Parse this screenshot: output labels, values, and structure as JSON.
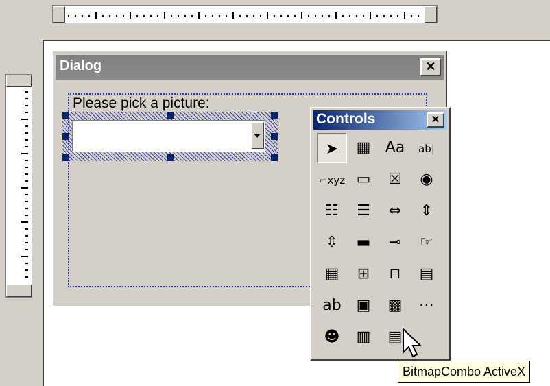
{
  "dialog": {
    "title": "Dialog",
    "close_glyph": "✕",
    "label": "Please pick a picture:"
  },
  "controls": {
    "title": "Controls",
    "close_glyph": "✕",
    "tools": [
      {
        "name": "pointer-tool-icon",
        "glyph": "➤"
      },
      {
        "name": "image-tool-icon",
        "glyph": "▦"
      },
      {
        "name": "label-tool-icon",
        "glyph": "Aa"
      },
      {
        "name": "textbox-tool-icon",
        "glyph": "ab|"
      },
      {
        "name": "frame-tool-icon",
        "glyph": "⌐xyz"
      },
      {
        "name": "button-tool-icon",
        "glyph": "▭"
      },
      {
        "name": "checkbox-tool-icon",
        "glyph": "☒"
      },
      {
        "name": "option-button-tool-icon",
        "glyph": "◉"
      },
      {
        "name": "listbox-tool-icon",
        "glyph": "☷"
      },
      {
        "name": "combobox-tool-icon",
        "glyph": "☰"
      },
      {
        "name": "scrollbar-tool-icon",
        "glyph": "⇔"
      },
      {
        "name": "spinbutton-tool-icon",
        "glyph": "⇕"
      },
      {
        "name": "vscroll-tool-icon",
        "glyph": "⇳"
      },
      {
        "name": "progressbar-tool-icon",
        "glyph": "▬"
      },
      {
        "name": "slider-tool-icon",
        "glyph": "⊸"
      },
      {
        "name": "hyperlink-tool-icon",
        "glyph": "☞"
      },
      {
        "name": "calendar-tool-icon",
        "glyph": "▦"
      },
      {
        "name": "treeview-tool-icon",
        "glyph": "⊞"
      },
      {
        "name": "tabstrip-tool-icon",
        "glyph": "⊓"
      },
      {
        "name": "animation-tool-icon",
        "glyph": "▤"
      },
      {
        "name": "edit-field-tool-icon",
        "glyph": "ab"
      },
      {
        "name": "picture-tool-icon",
        "glyph": "▣"
      },
      {
        "name": "grid-tool-icon",
        "glyph": "▩"
      },
      {
        "name": "ellipsis-tool-icon",
        "glyph": "⋯"
      },
      {
        "name": "agent-tool-icon",
        "glyph": "☻"
      },
      {
        "name": "imagelist-tool-icon",
        "glyph": "▥"
      },
      {
        "name": "bitmapcombo-tool-icon",
        "glyph": "▤"
      }
    ]
  },
  "tooltip": {
    "text": "BitmapCombo ActiveX"
  },
  "colors": {
    "controls_title_start": "#0a246a",
    "controls_title_end": "#a6caf0",
    "dialog_title": "#808080",
    "selection_handle": "#0a246a",
    "group_border": "#2233dd"
  }
}
